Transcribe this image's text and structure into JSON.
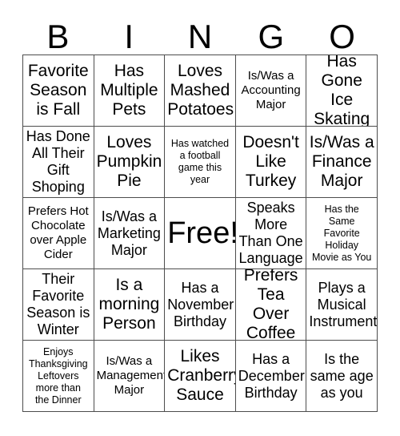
{
  "card": {
    "title": "BINGO",
    "free_space_label": "Free!",
    "border_color": "#4d4d4d",
    "text_color": "#000000",
    "background_color": "#ffffff"
  },
  "header": {
    "letters": [
      "B",
      "I",
      "N",
      "G",
      "O"
    ]
  },
  "grid": {
    "rows": 5,
    "columns": 5,
    "cells": [
      [
        {
          "text": "Favorite\nSeason\nis Fall",
          "size": "lg",
          "free": false
        },
        {
          "text": "Has\nMultiple\nPets",
          "size": "lg",
          "free": false
        },
        {
          "text": "Loves\nMashed\nPotatoes",
          "size": "lg",
          "free": false
        },
        {
          "text": "Is/Was a\nAccounting\nMajor",
          "size": "sm",
          "free": false
        },
        {
          "text": "Has\nGone Ice\nSkating",
          "size": "lg",
          "free": false
        }
      ],
      [
        {
          "text": "Has Done\nAll Their\nGift\nShoping",
          "size": "md",
          "free": false
        },
        {
          "text": "Loves\nPumpkin\nPie",
          "size": "lg",
          "free": false
        },
        {
          "text": "Has watched\na football\ngame this\nyear",
          "size": "xs",
          "free": false
        },
        {
          "text": "Doesn't\nLike\nTurkey",
          "size": "lg",
          "free": false
        },
        {
          "text": "Is/Was a\nFinance\nMajor",
          "size": "lg",
          "free": false
        }
      ],
      [
        {
          "text": "Prefers Hot\nChocolate\nover Apple\nCider",
          "size": "sm",
          "free": false
        },
        {
          "text": "Is/Was a\nMarketing\nMajor",
          "size": "md",
          "free": false
        },
        {
          "text": "Free!",
          "size": "xl",
          "free": true
        },
        {
          "text": "Speaks\nMore\nThan One\nLanguage",
          "size": "md",
          "free": false
        },
        {
          "text": "Has the\nSame\nFavorite\nHoliday\nMovie as You",
          "size": "xs",
          "free": false
        }
      ],
      [
        {
          "text": "Their\nFavorite\nSeason is\nWinter",
          "size": "md",
          "free": false
        },
        {
          "text": "Is a\nmorning\nPerson",
          "size": "lg",
          "free": false
        },
        {
          "text": "Has a\nNovember\nBirthday",
          "size": "md",
          "free": false
        },
        {
          "text": "Prefers\nTea Over\nCoffee",
          "size": "lg",
          "free": false
        },
        {
          "text": "Plays a\nMusical\nInstrument",
          "size": "md",
          "free": false
        }
      ],
      [
        {
          "text": "Enjoys\nThanksgiving\nLeftovers\nmore than\nthe Dinner",
          "size": "xs",
          "free": false
        },
        {
          "text": "Is/Was a\nManagement\nMajor",
          "size": "sm",
          "free": false
        },
        {
          "text": "Likes\nCranberry\nSauce",
          "size": "lg",
          "free": false
        },
        {
          "text": "Has a\nDecember\nBirthday",
          "size": "md",
          "free": false
        },
        {
          "text": "Is the\nsame age\nas you",
          "size": "md",
          "free": false
        }
      ]
    ]
  }
}
